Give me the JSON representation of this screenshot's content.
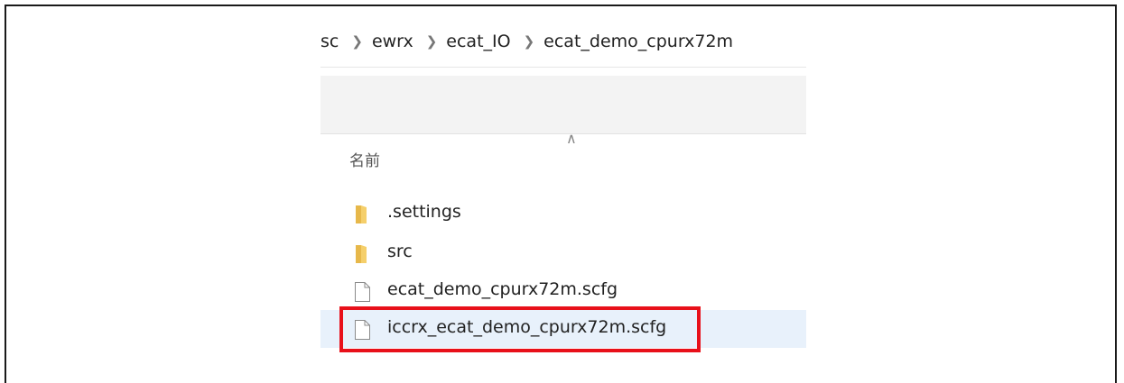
{
  "breadcrumb": [
    "sc",
    "ewrx",
    "ecat_IO",
    "ecat_demo_cpurx72m"
  ],
  "header": {
    "name_label": "名前"
  },
  "files": [
    {
      "name": ".settings",
      "icon": "folder-icon"
    },
    {
      "name": "src",
      "icon": "folder-icon"
    },
    {
      "name": "ecat_demo_cpurx72m.scfg",
      "icon": "file-icon"
    },
    {
      "name": "iccrx_ecat_demo_cpurx72m.scfg",
      "icon": "file-icon",
      "selected": true,
      "highlighted": true
    }
  ],
  "colors": {
    "highlight": "#e8101a",
    "selection": "#e8f1fb",
    "folder": "#e7b84a"
  }
}
